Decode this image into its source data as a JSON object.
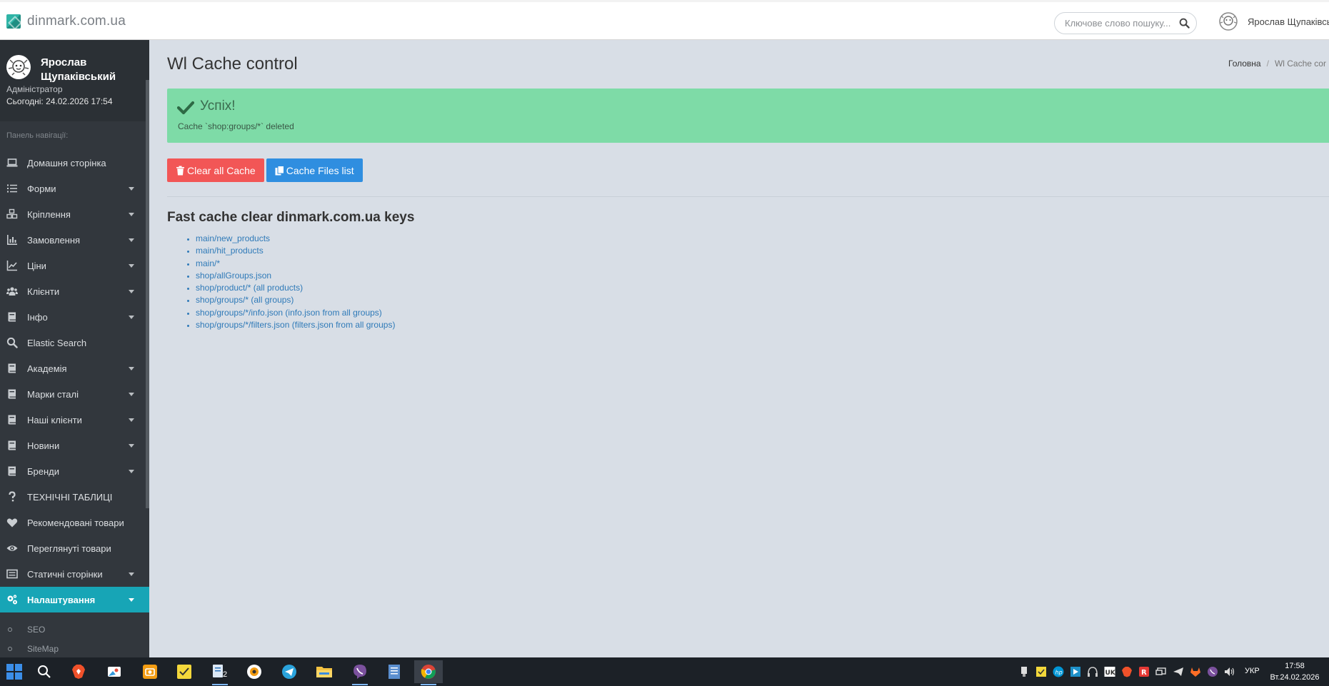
{
  "topbar": {
    "brand_name": "dinmark.com.ua",
    "search_placeholder": "Ключове слово пошуку...",
    "user_name": "Ярослав Щупаківськ"
  },
  "sidebar": {
    "user": {
      "name": "Ярослав Щупаківський",
      "role": "Адміністратор",
      "today": "Сьогодні: 24.02.2026 17:54"
    },
    "nav_label": "Панель навігації:",
    "items": [
      {
        "label": "Домашня сторінка",
        "icon": "laptop-icon",
        "has_submenu": false
      },
      {
        "label": "Форми",
        "icon": "list-icon",
        "has_submenu": true
      },
      {
        "label": "Кріплення",
        "icon": "cubes-icon",
        "has_submenu": true
      },
      {
        "label": "Замовлення",
        "icon": "bar-chart-icon",
        "has_submenu": true
      },
      {
        "label": "Ціни",
        "icon": "line-chart-icon",
        "has_submenu": true
      },
      {
        "label": "Клієнти",
        "icon": "users-icon",
        "has_submenu": true
      },
      {
        "label": "Інфо",
        "icon": "book-icon",
        "has_submenu": true
      },
      {
        "label": "Elastic Search",
        "icon": "search-icon",
        "has_submenu": false
      },
      {
        "label": "Академія",
        "icon": "book-icon",
        "has_submenu": true
      },
      {
        "label": "Марки сталі",
        "icon": "book-icon",
        "has_submenu": true
      },
      {
        "label": "Наші клієнти",
        "icon": "book-icon",
        "has_submenu": true
      },
      {
        "label": "Новини",
        "icon": "book-icon",
        "has_submenu": true
      },
      {
        "label": "Бренди",
        "icon": "book-icon",
        "has_submenu": true
      },
      {
        "label": "ТЕХНІЧНІ ТАБЛИЦІ",
        "icon": "question-icon",
        "has_submenu": false
      },
      {
        "label": "Рекомендовані товари",
        "icon": "heart-icon",
        "has_submenu": false
      },
      {
        "label": "Переглянуті товари",
        "icon": "eye-icon",
        "has_submenu": false
      },
      {
        "label": "Статичні сторінки",
        "icon": "page-icon",
        "has_submenu": true
      },
      {
        "label": "Налаштування",
        "icon": "cogs-icon",
        "has_submenu": true,
        "active": true
      }
    ],
    "subitems": [
      {
        "label": "SEO"
      },
      {
        "label": "SiteMap"
      }
    ]
  },
  "main": {
    "page_title": "Wl Cache control",
    "breadcrumb": {
      "home": "Головна",
      "current": "Wl Cache cor"
    },
    "alert": {
      "title": "Успіх!",
      "message": "Cache `shop:groups/*` deleted",
      "close": "×"
    },
    "buttons": {
      "clear_all": "Clear all Cache",
      "files_list": "Cache Files list"
    },
    "subheading": "Fast cache clear dinmark.com.ua keys",
    "keys": [
      "main/new_products",
      "main/hit_products",
      "main/*",
      "shop/allGroups.json",
      "shop/product/* (all products)",
      "shop/groups/* (all groups)",
      "shop/groups/*/info.json (info.json from all groups)",
      "shop/groups/*/filters.json (filters.json from all groups)"
    ]
  },
  "taskbar": {
    "apps": [
      "windows-start-icon",
      "search-icon",
      "brave-browser-icon",
      "photos-app-icon",
      "camera-app-icon",
      "sticky-notes-icon",
      "task-app-icon",
      "podcast-app-icon",
      "telegram-icon",
      "file-explorer-icon",
      "viber-icon",
      "notepad-app-icon",
      "chrome-icon"
    ],
    "task_badge": "2",
    "language": "УКР",
    "time": "17:58",
    "date": "Вт.24.02.2026"
  },
  "colors": {
    "sidebar_bg": "#32373d",
    "active_nav": "#17a5b6",
    "alert_bg": "#7edba7",
    "btn_red": "#f25656",
    "btn_blue": "#2f8ee0",
    "link": "#2f7ab8",
    "content_bg": "#d8dee6"
  }
}
